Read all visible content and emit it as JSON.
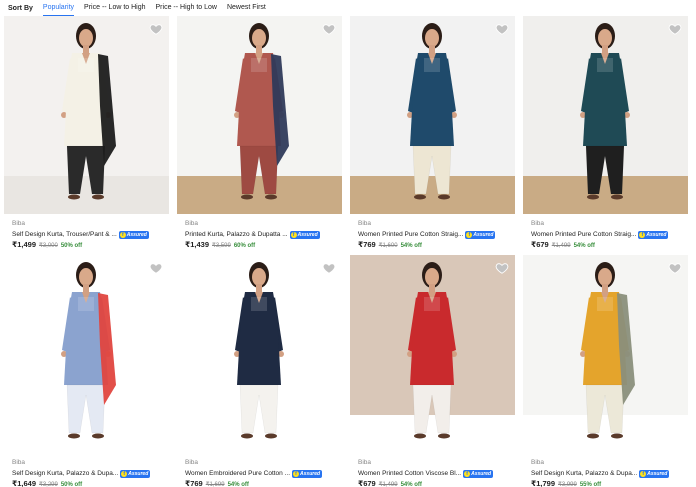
{
  "sort": {
    "label": "Sort By",
    "options": [
      "Popularity",
      "Price -- Low to High",
      "Price -- High to Low",
      "Newest First"
    ],
    "active": "Popularity"
  },
  "colors": {
    "accent": "#2874f0",
    "discount": "#388e3c",
    "assured_badge": "#2874f0"
  },
  "assured_label": "Assured",
  "products": [
    {
      "brand": "Biba",
      "title": "Self Design Kurta, Trouser/Pant & ...",
      "price": "₹1,499",
      "mrp": "₹3,000",
      "off": "50% off",
      "bg": "#f3f1ef",
      "kurta": "#f4f1e6",
      "dupatta": "#1c1c1c",
      "bottom": "#2a2a2a",
      "floor": "#e9e6e2"
    },
    {
      "brand": "Biba",
      "title": "Printed Kurta, Palazzo & Dupatta ...",
      "price": "₹1,439",
      "mrp": "₹3,599",
      "off": "60% off",
      "bg": "#f4f4f2",
      "kurta": "#b0584f",
      "dupatta": "#2f3a5a",
      "bottom": "#9e4a42",
      "floor": "#c9ab85"
    },
    {
      "brand": "Biba",
      "title": "Women Printed Pure Cotton Straig...",
      "price": "₹769",
      "mrp": "₹1,600",
      "off": "54% off",
      "bg": "#f2f2f2",
      "kurta": "#1f4a6b",
      "dupatta": "",
      "bottom": "#ede6d3",
      "floor": "#c9ab85"
    },
    {
      "brand": "Biba",
      "title": "Women Printed Pure Cotton Straig...",
      "price": "₹679",
      "mrp": "₹1,499",
      "off": "54% off",
      "bg": "#f0efed",
      "kurta": "#1f4a55",
      "dupatta": "",
      "bottom": "#1f1f1f",
      "floor": "#c9ab85"
    },
    {
      "brand": "Biba",
      "title": "Self Design Kurta, Palazzo & Dupa...",
      "price": "₹1,649",
      "mrp": "₹3,299",
      "off": "50% off",
      "bg": "#ffffff",
      "kurta": "#8ba3cf",
      "dupatta": "#e0463f",
      "bottom": "#e4e9f3",
      "floor": "#ffffff"
    },
    {
      "brand": "Biba",
      "title": "Women Embroidered Pure Cotton ...",
      "price": "₹769",
      "mrp": "₹1,699",
      "off": "54% off",
      "bg": "#ffffff",
      "kurta": "#1f2b43",
      "dupatta": "",
      "bottom": "#f4f2ee",
      "floor": "#ffffff"
    },
    {
      "brand": "Biba",
      "title": "Women Printed Cotton Viscose Bl...",
      "price": "₹679",
      "mrp": "₹1,499",
      "off": "54% off",
      "bg": "#d9c7b8",
      "kurta": "#c92a2d",
      "dupatta": "",
      "bottom": "#f2eeea",
      "floor": "#ffffff"
    },
    {
      "brand": "Biba",
      "title": "Self Design Kurta, Palazzo & Dupa...",
      "price": "₹1,799",
      "mrp": "₹3,999",
      "off": "55% off",
      "bg": "#f5f5f3",
      "kurta": "#e4a42c",
      "dupatta": "#8a8f7b",
      "bottom": "#ece8d8",
      "floor": "#ffffff"
    }
  ]
}
